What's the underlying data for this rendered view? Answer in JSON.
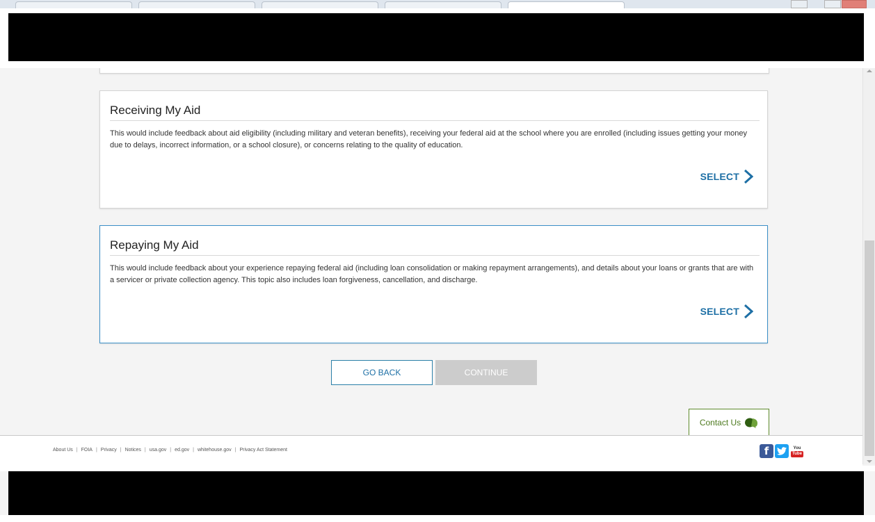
{
  "cards": [
    {
      "title": "Receiving My Aid",
      "description": "This would include feedback about aid eligibility (including military and veteran benefits), receiving your federal aid at the school where you are enrolled (including issues getting your money due to delays, incorrect information, or a school closure), or concerns relating to the quality of education.",
      "select_label": "SELECT"
    },
    {
      "title": "Repaying My Aid",
      "description": "This would include feedback about your experience repaying federal aid (including loan consolidation or making repayment arrangements), and details about your loans or grants that are with a servicer or private collection agency. This topic also includes loan forgiveness, cancellation, and discharge.",
      "select_label": "SELECT"
    }
  ],
  "buttons": {
    "back_label": "GO BACK",
    "continue_label": "CONTINUE"
  },
  "contact": {
    "label": "Contact Us"
  },
  "footer": {
    "links": [
      "About Us",
      "FOIA",
      "Privacy",
      "Notices",
      "usa.gov",
      "ed.gov",
      "whitehouse.gov",
      "Privacy Act Statement"
    ],
    "separator": "|"
  },
  "social": {
    "facebook_glyph": "f",
    "youtube_you": "You",
    "youtube_tube": "Tube"
  },
  "colors": {
    "accent": "#1d6fa5",
    "contact_green": "#4d7a1f",
    "continue_disabled": "#cccccc"
  }
}
